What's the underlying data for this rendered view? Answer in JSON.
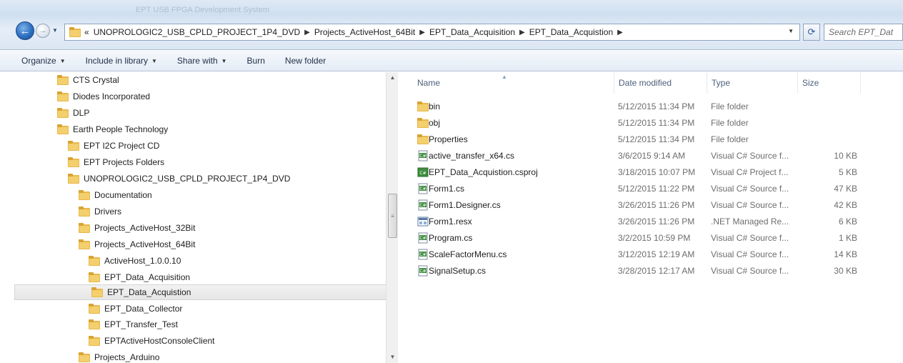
{
  "window": {
    "title_ghost": "EPT USB FPGA Development System"
  },
  "address": {
    "prefix": "«",
    "crumbs": [
      "UNOPROLOGIC2_USB_CPLD_PROJECT_1P4_DVD",
      "Projects_ActiveHost_64Bit",
      "EPT_Data_Acquisition",
      "EPT_Data_Acquistion"
    ]
  },
  "search": {
    "placeholder": "Search EPT_Dat"
  },
  "toolbar": {
    "organize": "Organize",
    "include_in_library": "Include in library",
    "share_with": "Share with",
    "burn": "Burn",
    "new_folder": "New folder"
  },
  "tree": [
    {
      "label": "CTS Crystal"
    },
    {
      "label": "Diodes Incorporated"
    },
    {
      "label": "DLP"
    },
    {
      "label": "Earth People Technology"
    },
    {
      "label": "EPT I2C Project CD"
    },
    {
      "label": "EPT Projects Folders"
    },
    {
      "label": "UNOPROLOGIC2_USB_CPLD_PROJECT_1P4_DVD"
    },
    {
      "label": "Documentation"
    },
    {
      "label": "Drivers"
    },
    {
      "label": "Projects_ActiveHost_32Bit"
    },
    {
      "label": "Projects_ActiveHost_64Bit"
    },
    {
      "label": "ActiveHost_1.0.0.10"
    },
    {
      "label": "EPT_Data_Acquisition"
    },
    {
      "label": "EPT_Data_Acquistion"
    },
    {
      "label": "EPT_Data_Collector"
    },
    {
      "label": "EPT_Transfer_Test"
    },
    {
      "label": "EPTActiveHostConsoleClient"
    },
    {
      "label": "Projects_Arduino"
    }
  ],
  "columns": {
    "name": "Name",
    "date_modified": "Date modified",
    "type": "Type",
    "size": "Size"
  },
  "files": [
    {
      "name": "bin",
      "date": "5/12/2015 11:34 PM",
      "type": "File folder",
      "size": "",
      "icon": "folder-icon"
    },
    {
      "name": "obj",
      "date": "5/12/2015 11:34 PM",
      "type": "File folder",
      "size": "",
      "icon": "folder-icon"
    },
    {
      "name": "Properties",
      "date": "5/12/2015 11:34 PM",
      "type": "File folder",
      "size": "",
      "icon": "folder-icon"
    },
    {
      "name": "active_transfer_x64.cs",
      "date": "3/6/2015 9:14 AM",
      "type": "Visual C# Source f...",
      "size": "10 KB",
      "icon": "csharp-file-icon"
    },
    {
      "name": "EPT_Data_Acquistion.csproj",
      "date": "3/18/2015 10:07 PM",
      "type": "Visual C# Project f...",
      "size": "5 KB",
      "icon": "csproj-file-icon"
    },
    {
      "name": "Form1.cs",
      "date": "5/12/2015 11:22 PM",
      "type": "Visual C# Source f...",
      "size": "47 KB",
      "icon": "csharp-file-icon"
    },
    {
      "name": "Form1.Designer.cs",
      "date": "3/26/2015 11:26 PM",
      "type": "Visual C# Source f...",
      "size": "42 KB",
      "icon": "csharp-file-icon"
    },
    {
      "name": "Form1.resx",
      "date": "3/26/2015 11:26 PM",
      "type": ".NET Managed Re...",
      "size": "6 KB",
      "icon": "resx-file-icon"
    },
    {
      "name": "Program.cs",
      "date": "3/2/2015 10:59 PM",
      "type": "Visual C# Source f...",
      "size": "1 KB",
      "icon": "csharp-file-icon"
    },
    {
      "name": "ScaleFactorMenu.cs",
      "date": "3/12/2015 12:19 AM",
      "type": "Visual C# Source f...",
      "size": "14 KB",
      "icon": "csharp-file-icon"
    },
    {
      "name": "SignalSetup.cs",
      "date": "3/28/2015 12:17 AM",
      "type": "Visual C# Source f...",
      "size": "30 KB",
      "icon": "csharp-file-icon"
    }
  ],
  "colors": {
    "folder": "#e8b84a",
    "selection": "#e8e8e8",
    "header_text": "#4c607a"
  }
}
